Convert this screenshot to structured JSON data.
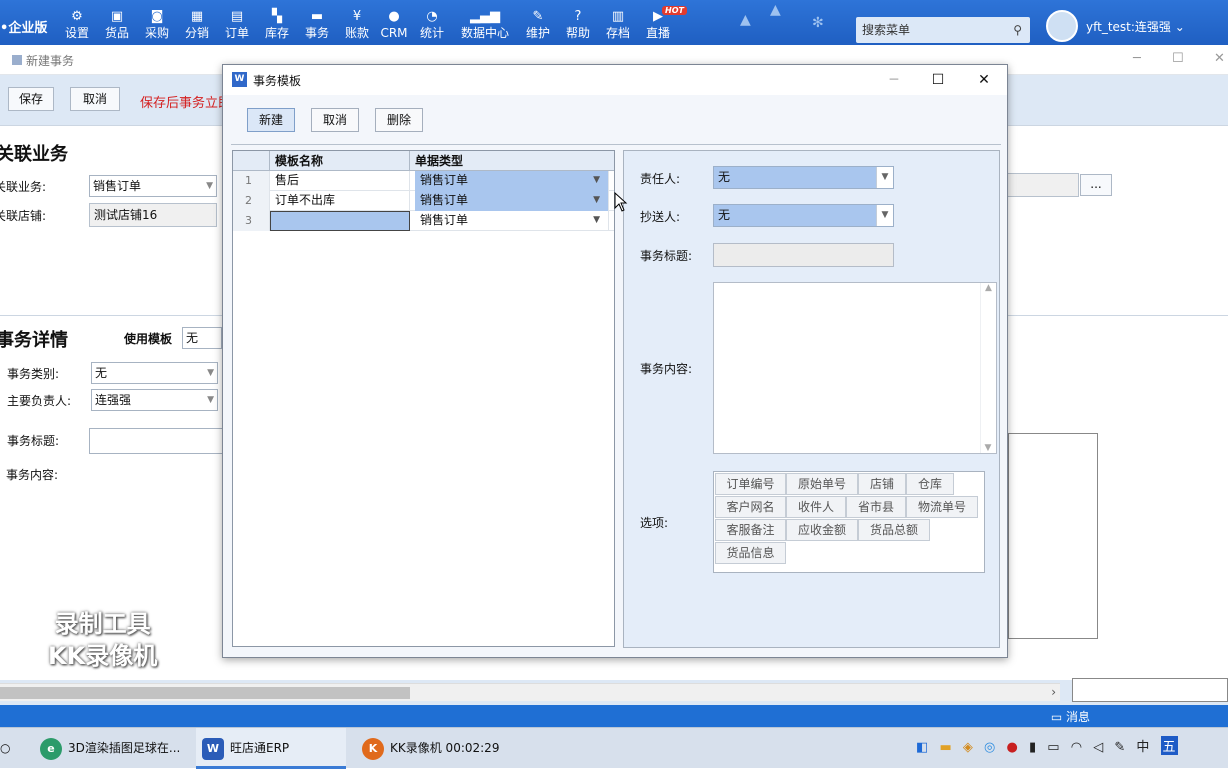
{
  "topbar": {
    "edition": "企业版",
    "nav": [
      {
        "label": "设置",
        "icon": "gear-icon"
      },
      {
        "label": "货品",
        "icon": "box-icon"
      },
      {
        "label": "采购",
        "icon": "purchase-icon"
      },
      {
        "label": "分销",
        "icon": "distribution-icon"
      },
      {
        "label": "订单",
        "icon": "order-icon"
      },
      {
        "label": "库存",
        "icon": "inventory-icon"
      },
      {
        "label": "事务",
        "icon": "chat-icon"
      },
      {
        "label": "账款",
        "icon": "yen-icon"
      },
      {
        "label": "CRM",
        "icon": "person-icon"
      },
      {
        "label": "统计",
        "icon": "pie-icon"
      },
      {
        "label": "数据中心",
        "icon": "bar-chart-icon"
      },
      {
        "label": "维护",
        "icon": "wrench-icon"
      },
      {
        "label": "帮助",
        "icon": "help-icon"
      },
      {
        "label": "存档",
        "icon": "archive-icon"
      },
      {
        "label": "直播",
        "icon": "video-icon"
      }
    ],
    "hot_badge": "HOT",
    "search_placeholder": "搜索菜单",
    "username": "yft_test:连强强"
  },
  "bg_window": {
    "title": "新建事务",
    "save_label": "保存",
    "cancel_label": "取消",
    "warning": "保存后事务立即",
    "section1": "关联业务",
    "rel_business_label": "关联业务:",
    "rel_business_value": "销售订单",
    "rel_shop_label": "关联店铺:",
    "rel_shop_value": "测试店铺16",
    "more_button": "...",
    "section2": "事务详情",
    "use_template_label": "使用模板",
    "use_template_value": "无",
    "category_label": "事务类别:",
    "category_value": "无",
    "owner_label": "主要负责人:",
    "owner_value": "连强强",
    "title_label": "事务标题:",
    "content_label": "事务内容:"
  },
  "modal": {
    "title": "事务模板",
    "logo": "W",
    "new_label": "新建",
    "cancel_label": "取消",
    "delete_label": "删除",
    "grid": {
      "headers": [
        "模板名称",
        "单据类型"
      ],
      "rows": [
        {
          "num": "1",
          "name": "售后",
          "type": "销售订单"
        },
        {
          "num": "2",
          "name": "订单不出库",
          "type": "销售订单"
        },
        {
          "num": "3",
          "name": "",
          "type": "销售订单"
        }
      ]
    },
    "responsible_label": "责任人:",
    "responsible_value": "无",
    "cc_label": "抄送人:",
    "cc_value": "无",
    "title_label": "事务标题:",
    "content_label": "事务内容:",
    "options_label": "选项:",
    "options": [
      "订单编号",
      "原始单号",
      "店铺",
      "仓库",
      "客户网名",
      "收件人",
      "省市县",
      "物流单号",
      "客服备注",
      "应收金额",
      "货品总额",
      "货品信息"
    ]
  },
  "status": {
    "message": "消息"
  },
  "watermark": {
    "line1": "录制工具",
    "line2": "KK录像机"
  },
  "taskbar": {
    "apps": [
      {
        "label": "3D渲染插图足球在...",
        "icon": "browser-icon"
      },
      {
        "label": "旺店通ERP",
        "icon": "erp-icon"
      },
      {
        "label": "KK录像机 00:02:29",
        "icon": "recorder-icon"
      }
    ],
    "ime": "中"
  }
}
